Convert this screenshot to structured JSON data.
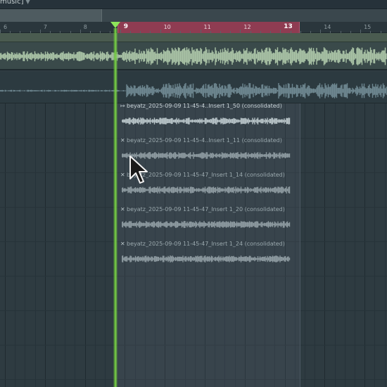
{
  "window": {
    "title": "music]"
  },
  "ruler": {
    "ticks": [
      {
        "label": "6",
        "inloop": false,
        "bold": false
      },
      {
        "label": "7",
        "inloop": false,
        "bold": false
      },
      {
        "label": "8",
        "inloop": false,
        "bold": false
      },
      {
        "label": "9",
        "inloop": true,
        "bold": true
      },
      {
        "label": "10",
        "inloop": true,
        "bold": false
      },
      {
        "label": "11",
        "inloop": true,
        "bold": false
      },
      {
        "label": "12",
        "inloop": true,
        "bold": false
      },
      {
        "label": "13",
        "inloop": true,
        "bold": true
      },
      {
        "label": "14",
        "inloop": false,
        "bold": false
      },
      {
        "label": "15",
        "inloop": false,
        "bold": false
      }
    ]
  },
  "clips": [
    {
      "label": "beyatz_2025-09-09 11-45-4..Insert 1_50 (consolidated)",
      "icon": "play-arrow-icon",
      "active": true
    },
    {
      "label": "beyatz_2025-09-09 11-45-4..Insert 1_11 (consolidated)",
      "icon": "close-icon",
      "active": false
    },
    {
      "label": "beyatz_2025-09-09 11-45-47_Insert 1_14 (consolidated)",
      "icon": "close-icon",
      "active": false
    },
    {
      "label": "beyatz_2025-09-09 11-45-47_Insert 1_20 (consolidated)",
      "icon": "close-icon",
      "active": false
    },
    {
      "label": "beyatz_2025-09-09 11-45-47_Insert 1_24 (consolidated)",
      "icon": "close-icon",
      "active": false
    }
  ],
  "colors": {
    "loop_region": "#8f3c52",
    "playhead": "#6cc23e",
    "track1_wave": "#a9c3a6",
    "track2_wave": "#6e8790",
    "clip_wave": "#8d9aa0"
  }
}
